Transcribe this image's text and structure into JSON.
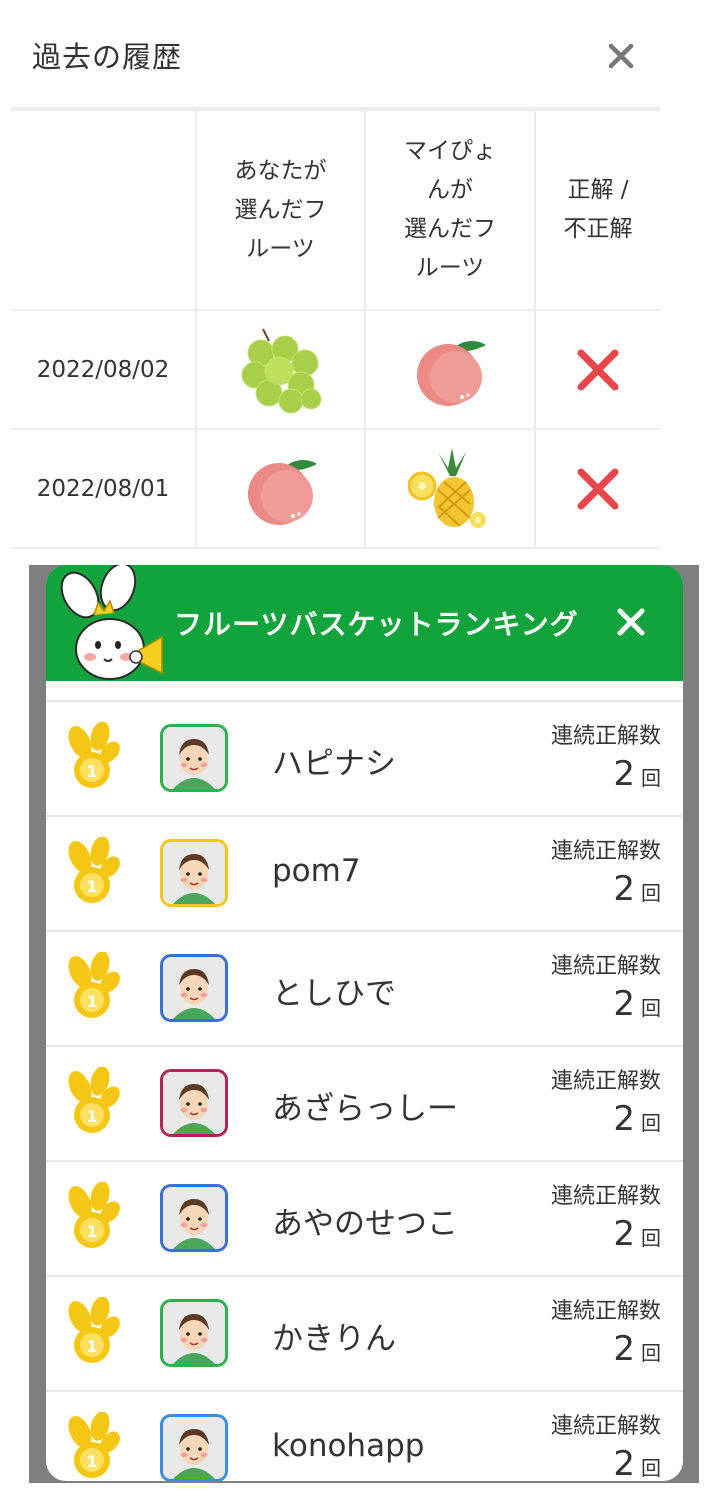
{
  "history": {
    "title": "過去の履歴",
    "headers": {
      "date": "",
      "your_fruit": "あなたが\n選んだフ\nルーツ",
      "mypyon_fruit": "マイぴょ\nんが\n選んだフ\nルーツ",
      "result": "正解 /\n不正解"
    },
    "rows": [
      {
        "date": "2022/08/02",
        "your_fruit": "grape-icon",
        "mypyon_fruit": "peach-icon",
        "result": "incorrect"
      },
      {
        "date": "2022/08/01",
        "your_fruit": "peach-icon",
        "mypyon_fruit": "pineapple-icon",
        "result": "incorrect"
      }
    ]
  },
  "ranking": {
    "title": "フルーツバスケットランキング",
    "header_color": "#12a33c",
    "streak_label": "連続正解数",
    "unit": "回",
    "entries": [
      {
        "name": "ハピナシ",
        "count": "2",
        "avatar": "woman-avatar",
        "border": "#2bb24c"
      },
      {
        "name": "pom7",
        "count": "2",
        "avatar": "bears-photo-avatar",
        "border": "#f3c61a"
      },
      {
        "name": "としひで",
        "count": "2",
        "avatar": "man-avatar",
        "border": "#3a6fd8"
      },
      {
        "name": "あざらっしー",
        "count": "2",
        "avatar": "green-hat-avatar",
        "border": "#b0245a"
      },
      {
        "name": "あやのせつこ",
        "count": "2",
        "avatar": "woman-avatar",
        "border": "#3a6fd8"
      },
      {
        "name": "かきりん",
        "count": "2",
        "avatar": "woman-avatar",
        "border": "#2bb24c"
      },
      {
        "name": "konohapp",
        "count": "2",
        "avatar": "man-avatar",
        "border": "#3a8ee0"
      }
    ]
  }
}
